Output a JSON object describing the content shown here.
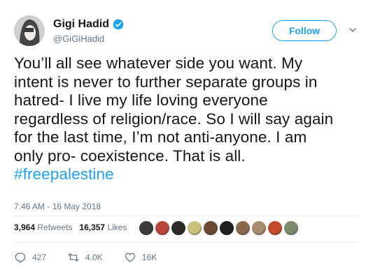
{
  "header": {
    "display_name": "Gigi Hadid",
    "handle": "@GiGiHadid",
    "follow_label": "Follow"
  },
  "tweet": {
    "lines": [
      "You’ll all see whatever side you want. My",
      "intent is never to further separate groups in",
      "hatred- I live my life loving everyone",
      "regardless of religion/race. So I will say again",
      "for the last time, I’m not anti-anyone. I am",
      "only pro- coexistence. That is all."
    ],
    "hashtag": "#freepalestine",
    "timestamp": "7:46 AM - 16 May 2018"
  },
  "stats": {
    "retweets_count": "3,964",
    "retweets_label": "Retweets",
    "likes_count": "16,357",
    "likes_label": "Likes"
  },
  "likers": {
    "colors": [
      "#3b3b3b",
      "#b7473d",
      "#2e2a28",
      "#c9c07a",
      "#6b4a35",
      "#1e1e1e",
      "#8a6a4e",
      "#a78b6a",
      "#c44b2a",
      "#7b8b6c"
    ]
  },
  "actions": {
    "reply_count": "427",
    "retweet_count": "4.0K",
    "like_count": "16K"
  },
  "colors": {
    "accent": "#1da1f2",
    "muted": "#657786",
    "text": "#14171a"
  }
}
